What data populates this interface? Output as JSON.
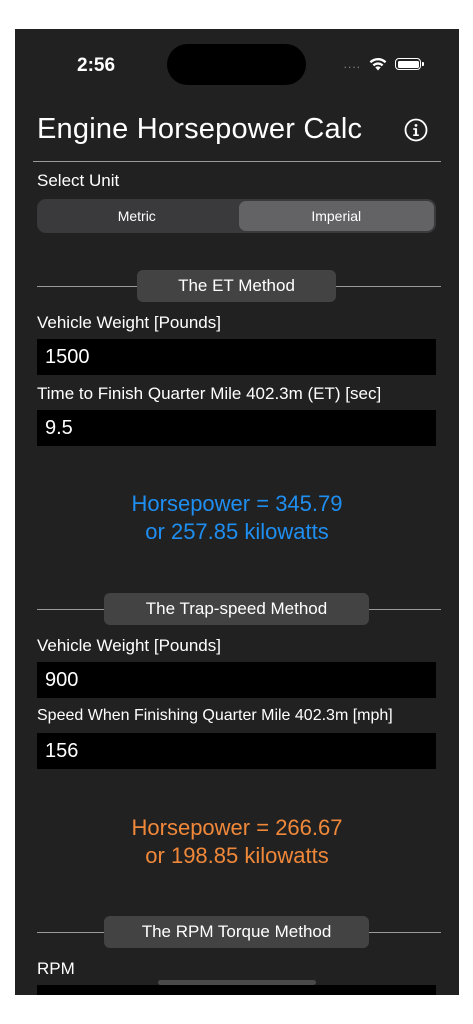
{
  "status": {
    "time": "2:56",
    "signal_dots": "....",
    "wifi_icon": "wifi-icon",
    "battery_icon": "battery-icon"
  },
  "header": {
    "title": "Engine Horsepower Calc",
    "info_icon": "info-icon"
  },
  "unit": {
    "label": "Select Unit",
    "options": [
      "Metric",
      "Imperial"
    ],
    "selected": "Imperial"
  },
  "et_method": {
    "title": "The ET Method",
    "weight_label": "Vehicle Weight [Pounds]",
    "weight_value": "1500",
    "time_label": "Time to Finish Quarter Mile 402.3m (ET) [sec]",
    "time_value": "9.5",
    "result_hp": "Horsepower = 345.79",
    "result_kw": "or 257.85 kilowatts",
    "result_color": "#1f8ef1"
  },
  "trap_method": {
    "title": "The Trap-speed Method",
    "weight_label": "Vehicle Weight [Pounds]",
    "weight_value": "900",
    "speed_label": "Speed When Finishing Quarter Mile 402.3m [mph]",
    "speed_value": "156",
    "result_hp": "Horsepower = 266.67",
    "result_kw": "or 198.85 kilowatts",
    "result_color": "#f0883a"
  },
  "rpm_method": {
    "title": "The RPM Torque Method",
    "rpm_label": "RPM"
  }
}
